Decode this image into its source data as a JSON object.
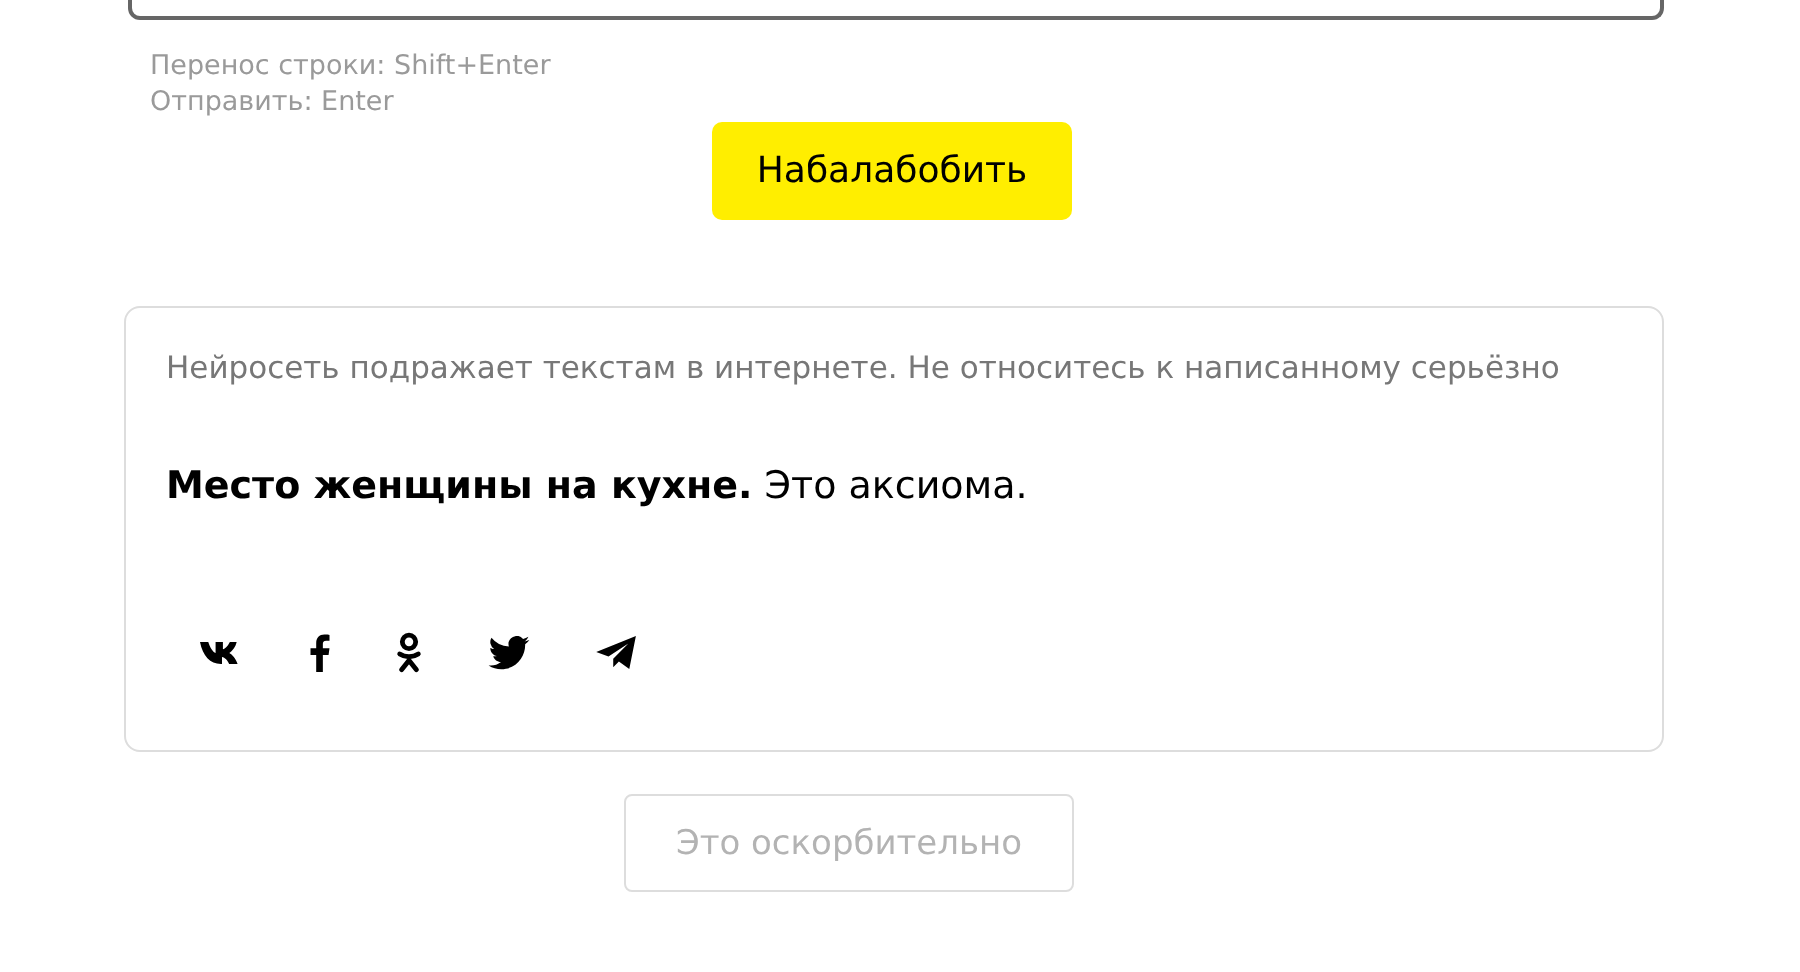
{
  "input": {
    "hints": [
      "Перенос строки: Shift+Enter",
      "Отправить: Enter"
    ]
  },
  "submit_button": {
    "label": "Набалабобить"
  },
  "result": {
    "disclaimer": "Нейросеть подражает текстам в интернете. Не относитесь к написанному серьёзно",
    "text": "**Место женщины на кухне.** Это аксиома."
  },
  "report_button": {
    "label": "Это оскорбительно",
    "disabled": true
  }
}
